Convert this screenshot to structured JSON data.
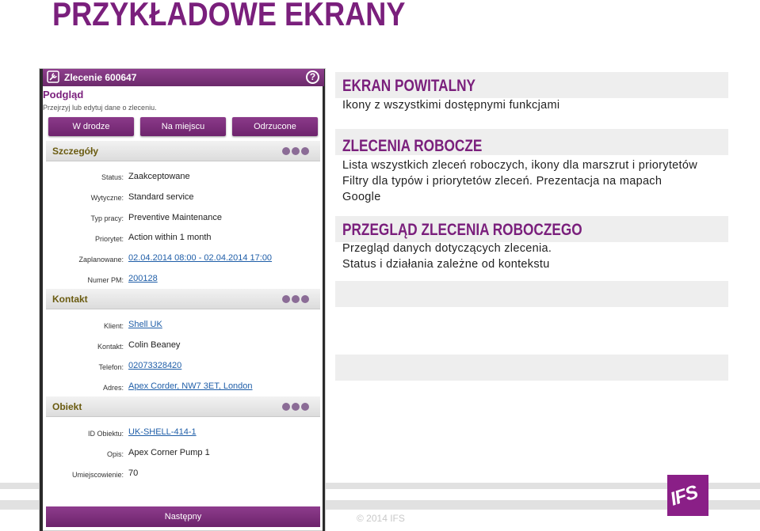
{
  "slide": {
    "title": "PRZYKŁADOWE EKRANY",
    "copyright": "© 2014 IFS",
    "logo_text": "IFS",
    "colors": {
      "brand": "#7a1f7c",
      "band": "#eeeeee"
    }
  },
  "phone": {
    "appbar_title": "Zlecenie 600647",
    "icons": {
      "app": "wrench-icon",
      "help": "help-icon"
    },
    "help_glyph": "?",
    "view_title": "Podgląd",
    "view_subtitle": "Przejrzyj lub edytuj dane o zleceniu.",
    "buttons": [
      "W drodze",
      "Na miejscu",
      "Odrzucone"
    ],
    "sections": [
      {
        "label": "Szczegóły",
        "fields": [
          {
            "label": "Status:",
            "value": "Zaakceptowane",
            "link": false
          },
          {
            "label": "Wytyczne:",
            "value": "Standard service",
            "link": false
          },
          {
            "label": "Typ pracy:",
            "value": "Preventive Maintenance",
            "link": false
          },
          {
            "label": "Priorytet:",
            "value": "Action within 1 month",
            "link": false
          },
          {
            "label": "Zaplanowane:",
            "value": "02.04.2014 08:00 - 02.04.2014 17:00",
            "link": true
          },
          {
            "label": "Numer PM:",
            "value": "200128",
            "link": true
          }
        ]
      },
      {
        "label": "Kontakt",
        "fields": [
          {
            "label": "Klient:",
            "value": "Shell UK",
            "link": true
          },
          {
            "label": "Kontakt:",
            "value": "Colin Beaney",
            "link": false
          },
          {
            "label": "Telefon:",
            "value": "02073328420",
            "link": true
          },
          {
            "label": "Adres:",
            "value": "Apex Corder, NW7 3ET, London",
            "link": true
          }
        ]
      },
      {
        "label": "Obiekt",
        "fields": [
          {
            "label": "ID Obiektu:",
            "value": "UK-SHELL-414-1",
            "link": true
          },
          {
            "label": "Opis:",
            "value": "Apex Corner Pump 1",
            "link": false
          },
          {
            "label": "Umiejscowienie:",
            "value": "70",
            "link": false
          }
        ]
      }
    ],
    "next_button": "Następny"
  },
  "panels": [
    {
      "heading": "EKRAN POWITALNY",
      "lines": [
        "Ikony z wszystkimi dostępnymi funkcjami"
      ]
    },
    {
      "heading": "ZLECENIA ROBOCZE",
      "lines": [
        "Lista wszystkich zleceń roboczych, ikony dla marszrut i priorytetów",
        "Filtry dla typów i priorytetów zleceń. Prezentacja na mapach",
        "Google"
      ]
    },
    {
      "heading": "PRZEGLĄD ZLECENIA ROBOCZEGO",
      "lines": [
        "Przegląd danych dotyczących zlecenia.",
        "Status i działania zależne od kontekstu"
      ]
    }
  ]
}
